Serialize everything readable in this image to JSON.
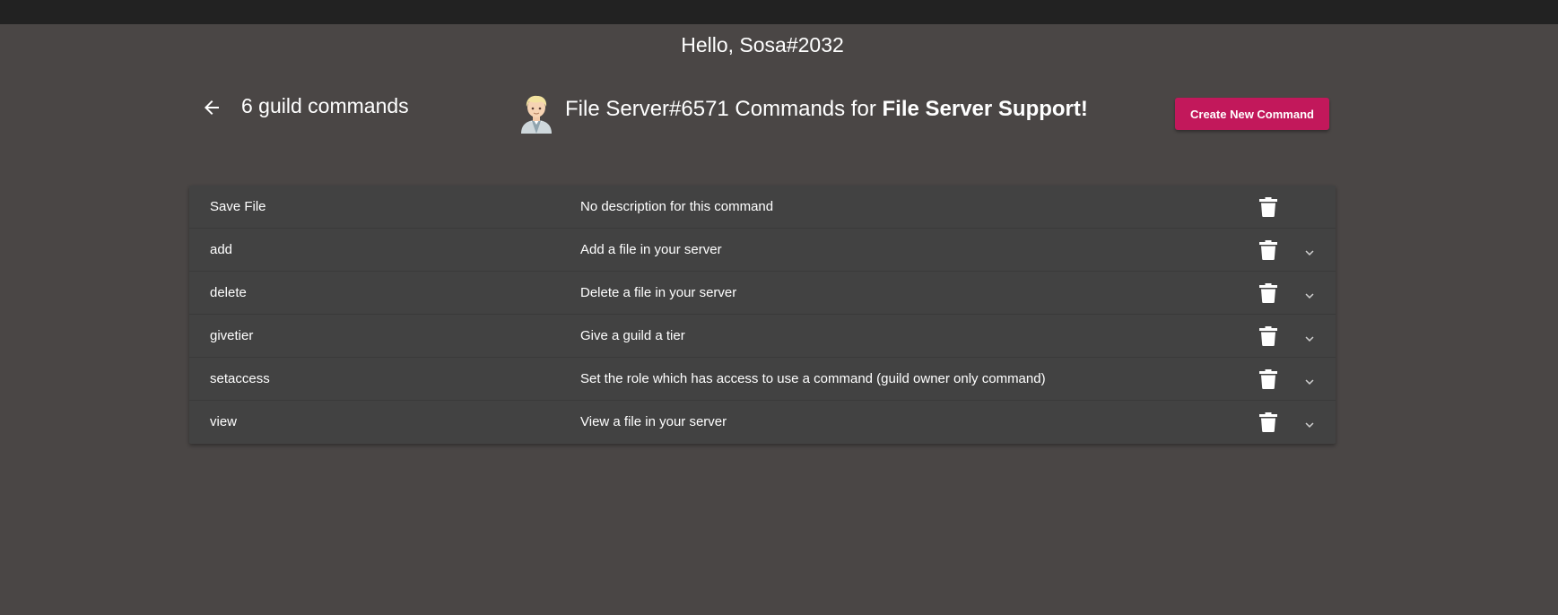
{
  "header": {
    "greeting": "Hello, Sosa#2032"
  },
  "title_bar": {
    "guild_count": "6 guild commands",
    "bot_name": "File Server#6571",
    "commands_for": " Commands for ",
    "guild_name": "File Server Support!",
    "create_button_label": "Create New Command"
  },
  "commands": [
    {
      "name": "Save File",
      "description": "No description for this command",
      "expandable": false
    },
    {
      "name": "add",
      "description": "Add a file in your server",
      "expandable": true
    },
    {
      "name": "delete",
      "description": "Delete a file in your server",
      "expandable": true
    },
    {
      "name": "givetier",
      "description": "Give a guild a tier",
      "expandable": true
    },
    {
      "name": "setaccess",
      "description": "Set the role which has access to use a command (guild owner only command)",
      "expandable": true
    },
    {
      "name": "view",
      "description": "View a file in your server",
      "expandable": true
    }
  ],
  "icons": {
    "back": "arrow-left-icon",
    "delete": "trash-icon",
    "expand": "chevron-down-icon",
    "avatar": "bot-avatar"
  },
  "colors": {
    "background": "#4a4645",
    "topbar": "#222222",
    "table": "#424242",
    "accent": "#c2185b"
  }
}
